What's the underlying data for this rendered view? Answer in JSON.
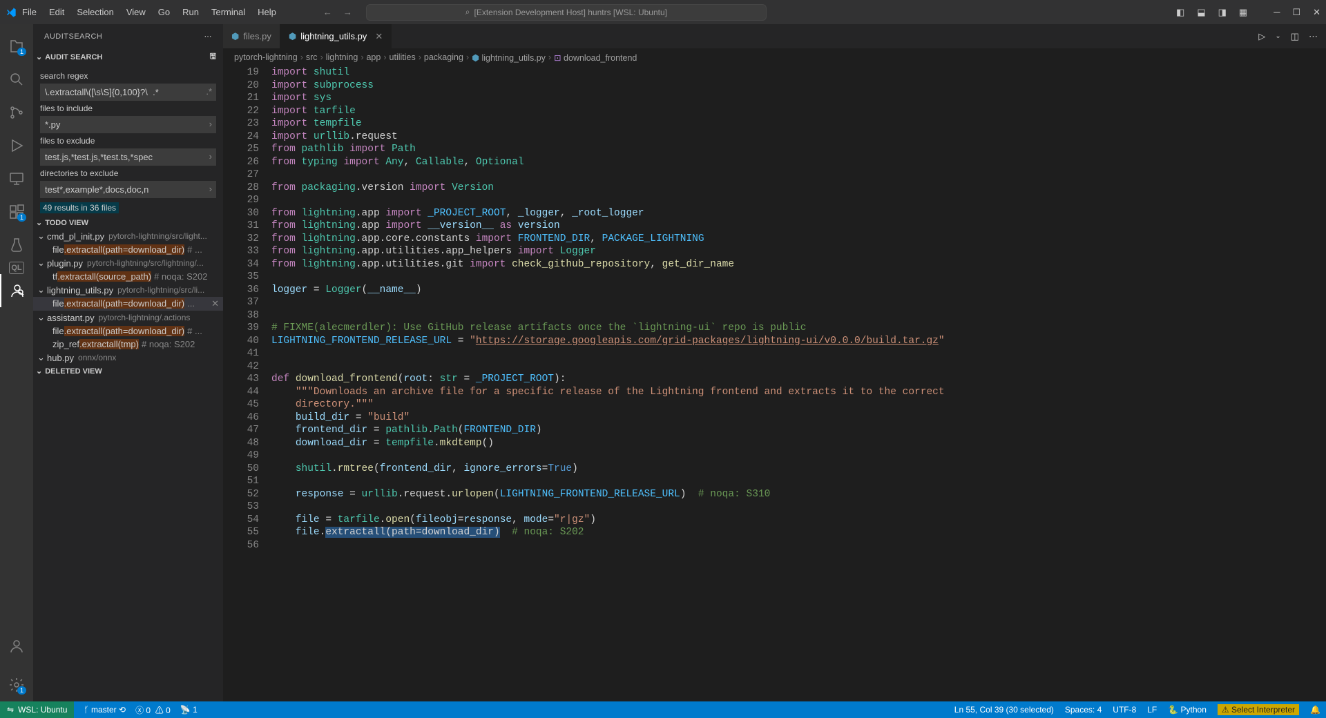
{
  "titlebar": {
    "menu": [
      "File",
      "Edit",
      "Selection",
      "View",
      "Go",
      "Run",
      "Terminal",
      "Help"
    ],
    "search_placeholder": "[Extension Development Host] huntrs [WSL: Ubuntu]"
  },
  "activity_badges": {
    "explorer": "1",
    "extensions": "1",
    "ports": "1"
  },
  "sidebar": {
    "title": "AUDITSEARCH",
    "sections": {
      "audit_search": "AUDIT SEARCH",
      "todo_view": "TODO VIEW",
      "deleted_view": "DELETED VIEW"
    },
    "labels": {
      "regex": "search regex",
      "include": "files to include",
      "exclude": "files to exclude",
      "dirs_exclude": "directories to exclude"
    },
    "inputs": {
      "regex": "\\.extractall\\([\\s\\S]{0,100}?\\  .*",
      "include": "*.py",
      "exclude": "test.js,*test.js,*test.ts,*spec",
      "dirs_exclude": "test*,example*,docs,doc,n"
    },
    "results_summary": "49 results in 36 files",
    "tree": [
      {
        "file": "cmd_pl_init.py",
        "path": "pytorch-lightning/src/light...",
        "matches": [
          {
            "pre": "file",
            "hl": ".extractall(path=download_dir)",
            "meta": "# ..."
          }
        ]
      },
      {
        "file": "plugin.py",
        "path": "pytorch-lightning/src/lightning/...",
        "matches": [
          {
            "pre": "tf",
            "hl": ".extractall(source_path)",
            "meta": "# noqa: S202"
          }
        ]
      },
      {
        "file": "lightning_utils.py",
        "path": "pytorch-lightning/src/li...",
        "selected": true,
        "matches": [
          {
            "pre": "file",
            "hl": ".extractall(path=download_dir)",
            "meta": "...",
            "selected": true,
            "dismiss": true
          }
        ]
      },
      {
        "file": "assistant.py",
        "path": "pytorch-lightning/.actions",
        "matches": [
          {
            "pre": "file",
            "hl": ".extractall(path=download_dir)",
            "meta": "# ..."
          },
          {
            "pre": "zip_ref",
            "hl": ".extractall(tmp)",
            "meta": "# noqa: S202"
          }
        ]
      },
      {
        "file": "hub.py",
        "path": "onnx/onnx",
        "matches": []
      }
    ]
  },
  "tabs": [
    {
      "label": "files.py",
      "active": false
    },
    {
      "label": "lightning_utils.py",
      "active": true
    }
  ],
  "breadcrumb": [
    "pytorch-lightning",
    "src",
    "lightning",
    "app",
    "utilities",
    "packaging",
    "lightning_utils.py",
    "download_frontend"
  ],
  "editor": {
    "first_line": 19,
    "lines": [
      [
        [
          "kw",
          "import"
        ],
        [
          "",
          " "
        ],
        [
          "mod",
          "shutil"
        ]
      ],
      [
        [
          "kw",
          "import"
        ],
        [
          "",
          " "
        ],
        [
          "mod",
          "subprocess"
        ]
      ],
      [
        [
          "kw",
          "import"
        ],
        [
          "",
          " "
        ],
        [
          "mod",
          "sys"
        ]
      ],
      [
        [
          "kw",
          "import"
        ],
        [
          "",
          " "
        ],
        [
          "mod",
          "tarfile"
        ]
      ],
      [
        [
          "kw",
          "import"
        ],
        [
          "",
          " "
        ],
        [
          "mod",
          "tempfile"
        ]
      ],
      [
        [
          "kw",
          "import"
        ],
        [
          "",
          " "
        ],
        [
          "mod",
          "urllib"
        ],
        [
          "",
          ".request"
        ]
      ],
      [
        [
          "kw",
          "from"
        ],
        [
          "",
          " "
        ],
        [
          "mod",
          "pathlib"
        ],
        [
          "",
          " "
        ],
        [
          "kw",
          "import"
        ],
        [
          "",
          " "
        ],
        [
          "cls",
          "Path"
        ]
      ],
      [
        [
          "kw",
          "from"
        ],
        [
          "",
          " "
        ],
        [
          "mod",
          "typing"
        ],
        [
          "",
          " "
        ],
        [
          "kw",
          "import"
        ],
        [
          "",
          " "
        ],
        [
          "cls",
          "Any"
        ],
        [
          "",
          ", "
        ],
        [
          "cls",
          "Callable"
        ],
        [
          "",
          ", "
        ],
        [
          "cls",
          "Optional"
        ]
      ],
      [
        [
          "",
          ""
        ]
      ],
      [
        [
          "kw",
          "from"
        ],
        [
          "",
          " "
        ],
        [
          "mod",
          "packaging"
        ],
        [
          "",
          ".version "
        ],
        [
          "kw",
          "import"
        ],
        [
          "",
          " "
        ],
        [
          "cls",
          "Version"
        ]
      ],
      [
        [
          "",
          ""
        ]
      ],
      [
        [
          "kw",
          "from"
        ],
        [
          "",
          " "
        ],
        [
          "mod",
          "lightning"
        ],
        [
          "",
          ".app "
        ],
        [
          "kw",
          "import"
        ],
        [
          "",
          " "
        ],
        [
          "const",
          "_PROJECT_ROOT"
        ],
        [
          "",
          ", "
        ],
        [
          "var",
          "_logger"
        ],
        [
          "",
          ", "
        ],
        [
          "var",
          "_root_logger"
        ]
      ],
      [
        [
          "kw",
          "from"
        ],
        [
          "",
          " "
        ],
        [
          "mod",
          "lightning"
        ],
        [
          "",
          ".app "
        ],
        [
          "kw",
          "import"
        ],
        [
          "",
          " "
        ],
        [
          "var",
          "__version__"
        ],
        [
          "",
          " "
        ],
        [
          "kw",
          "as"
        ],
        [
          "",
          " "
        ],
        [
          "var",
          "version"
        ]
      ],
      [
        [
          "kw",
          "from"
        ],
        [
          "",
          " "
        ],
        [
          "mod",
          "lightning"
        ],
        [
          "",
          ".app.core.constants "
        ],
        [
          "kw",
          "import"
        ],
        [
          "",
          " "
        ],
        [
          "const",
          "FRONTEND_DIR"
        ],
        [
          "",
          ", "
        ],
        [
          "const",
          "PACKAGE_LIGHTNING"
        ]
      ],
      [
        [
          "kw",
          "from"
        ],
        [
          "",
          " "
        ],
        [
          "mod",
          "lightning"
        ],
        [
          "",
          ".app.utilities.app_helpers "
        ],
        [
          "kw",
          "import"
        ],
        [
          "",
          " "
        ],
        [
          "cls",
          "Logger"
        ]
      ],
      [
        [
          "kw",
          "from"
        ],
        [
          "",
          " "
        ],
        [
          "mod",
          "lightning"
        ],
        [
          "",
          ".app.utilities.git "
        ],
        [
          "kw",
          "import"
        ],
        [
          "",
          " "
        ],
        [
          "fn",
          "check_github_repository"
        ],
        [
          "",
          ", "
        ],
        [
          "fn",
          "get_dir_name"
        ]
      ],
      [
        [
          "",
          ""
        ]
      ],
      [
        [
          "var",
          "logger"
        ],
        [
          "",
          " = "
        ],
        [
          "cls",
          "Logger"
        ],
        [
          "",
          "("
        ],
        [
          "var",
          "__name__"
        ],
        [
          "",
          ")"
        ]
      ],
      [
        [
          "",
          ""
        ]
      ],
      [
        [
          "",
          ""
        ]
      ],
      [
        [
          "cmt",
          "# FIXME(alecmerdler): Use GitHub release artifacts once the `lightning-ui` repo is public"
        ]
      ],
      [
        [
          "const",
          "LIGHTNING_FRONTEND_RELEASE_URL"
        ],
        [
          "",
          " = "
        ],
        [
          "str",
          "\""
        ],
        [
          "url",
          "https://storage.googleapis.com/grid-packages/lightning-ui/v0.0.0/build.tar.gz"
        ],
        [
          "str",
          "\""
        ]
      ],
      [
        [
          "",
          ""
        ]
      ],
      [
        [
          "",
          ""
        ]
      ],
      [
        [
          "kw",
          "def"
        ],
        [
          "",
          " "
        ],
        [
          "fn",
          "download_frontend"
        ],
        [
          "",
          "("
        ],
        [
          "var",
          "root"
        ],
        [
          "",
          ": "
        ],
        [
          "cls",
          "str"
        ],
        [
          "",
          " = "
        ],
        [
          "const",
          "_PROJECT_ROOT"
        ],
        [
          "",
          "):"
        ]
      ],
      [
        [
          "",
          "    "
        ],
        [
          "str",
          "\"\"\"Downloads an archive file for a specific release of the Lightning frontend and extracts it to the correct"
        ]
      ],
      [
        [
          "",
          "    "
        ],
        [
          "str",
          "directory.\"\"\""
        ]
      ],
      [
        [
          "",
          "    "
        ],
        [
          "var",
          "build_dir"
        ],
        [
          "",
          " = "
        ],
        [
          "str",
          "\"build\""
        ]
      ],
      [
        [
          "",
          "    "
        ],
        [
          "var",
          "frontend_dir"
        ],
        [
          "",
          " = "
        ],
        [
          "mod",
          "pathlib"
        ],
        [
          "",
          "."
        ],
        [
          "cls",
          "Path"
        ],
        [
          "",
          "("
        ],
        [
          "const",
          "FRONTEND_DIR"
        ],
        [
          "",
          ")"
        ]
      ],
      [
        [
          "",
          "    "
        ],
        [
          "var",
          "download_dir"
        ],
        [
          "",
          " = "
        ],
        [
          "mod",
          "tempfile"
        ],
        [
          "",
          "."
        ],
        [
          "fn",
          "mkdtemp"
        ],
        [
          "",
          "()"
        ]
      ],
      [
        [
          "",
          ""
        ]
      ],
      [
        [
          "",
          "    "
        ],
        [
          "mod",
          "shutil"
        ],
        [
          "",
          "."
        ],
        [
          "fn",
          "rmtree"
        ],
        [
          "",
          "("
        ],
        [
          "var",
          "frontend_dir"
        ],
        [
          "",
          ", "
        ],
        [
          "var",
          "ignore_errors"
        ],
        [
          "",
          "="
        ],
        [
          "num",
          "True"
        ],
        [
          "",
          ")"
        ]
      ],
      [
        [
          "",
          ""
        ]
      ],
      [
        [
          "",
          "    "
        ],
        [
          "var",
          "response"
        ],
        [
          "",
          " = "
        ],
        [
          "mod",
          "urllib"
        ],
        [
          "",
          ".request."
        ],
        [
          "fn",
          "urlopen"
        ],
        [
          "",
          "("
        ],
        [
          "const",
          "LIGHTNING_FRONTEND_RELEASE_URL"
        ],
        [
          "",
          ")  "
        ],
        [
          "cmt",
          "# noqa: S310"
        ]
      ],
      [
        [
          "",
          ""
        ]
      ],
      [
        [
          "",
          "    "
        ],
        [
          "var",
          "file"
        ],
        [
          "",
          " = "
        ],
        [
          "mod",
          "tarfile"
        ],
        [
          "",
          "."
        ],
        [
          "fn",
          "open"
        ],
        [
          "",
          "("
        ],
        [
          "var",
          "fileobj"
        ],
        [
          "",
          "="
        ],
        [
          "var",
          "response"
        ],
        [
          "",
          ", "
        ],
        [
          "var",
          "mode"
        ],
        [
          "",
          "="
        ],
        [
          "str",
          "\"r|gz\""
        ],
        [
          "",
          ")"
        ]
      ],
      [
        [
          "",
          "    "
        ],
        [
          "var",
          "file"
        ],
        [
          "",
          "."
        ],
        [
          "sel",
          "extractall"
        ],
        [
          "sel",
          "("
        ],
        [
          "sel",
          "path"
        ],
        [
          "sel",
          "="
        ],
        [
          "sel",
          "download_dir"
        ],
        [
          "sel",
          ")"
        ],
        [
          "",
          "  "
        ],
        [
          "cmt",
          "# noqa: S202"
        ]
      ],
      [
        [
          "",
          ""
        ]
      ]
    ]
  },
  "status": {
    "remote": "WSL: Ubuntu",
    "branch": "master",
    "errors": "0",
    "warnings": "0",
    "ports": "1",
    "position": "Ln 55, Col 39 (30 selected)",
    "spaces": "Spaces: 4",
    "encoding": "UTF-8",
    "eol": "LF",
    "language": "Python",
    "interpreter": "Select Interpreter"
  }
}
